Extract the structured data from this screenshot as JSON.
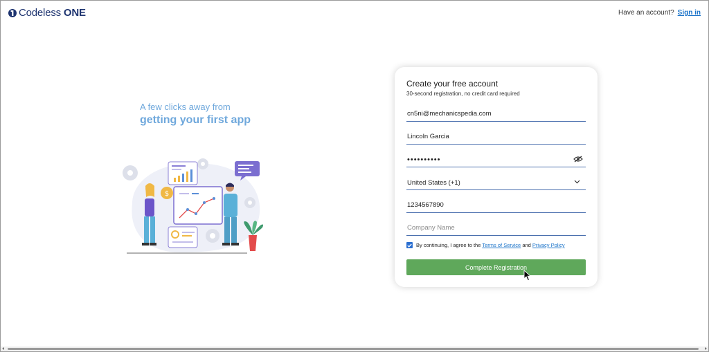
{
  "header": {
    "logo_text": "Codeless",
    "logo_text_bold": "ONE",
    "have_account": "Have an account?",
    "signin_label": "Sign in"
  },
  "hero": {
    "line1": "A few clicks away from",
    "line2": "getting your first app"
  },
  "form": {
    "title": "Create your free account",
    "subtitle": "30-second registration, no credit card required",
    "email": "cn5ni@mechanicspedia.com",
    "name": "Lincoln Garcia",
    "password": "••••••••••",
    "country": "United States (+1)",
    "phone": "1234567890",
    "company_placeholder": "Company Name",
    "agree_prefix": "By continuing, I agree to the",
    "terms_label": "Terms of Service",
    "and_text": "and",
    "privacy_label": "Privacy Policy",
    "submit_label": "Complete Registration"
  },
  "icons": {
    "logo": "codeless-logo-icon",
    "eye": "eye-off-icon",
    "chevron": "chevron-down-icon",
    "checkbox": "checkbox-checked-icon",
    "cursor": "mouse-pointer-icon"
  },
  "colors": {
    "accent": "#1a73c9",
    "submit": "#5fa85b",
    "tagline": "#6fa8dc",
    "field_underline": "#4a6fae"
  }
}
